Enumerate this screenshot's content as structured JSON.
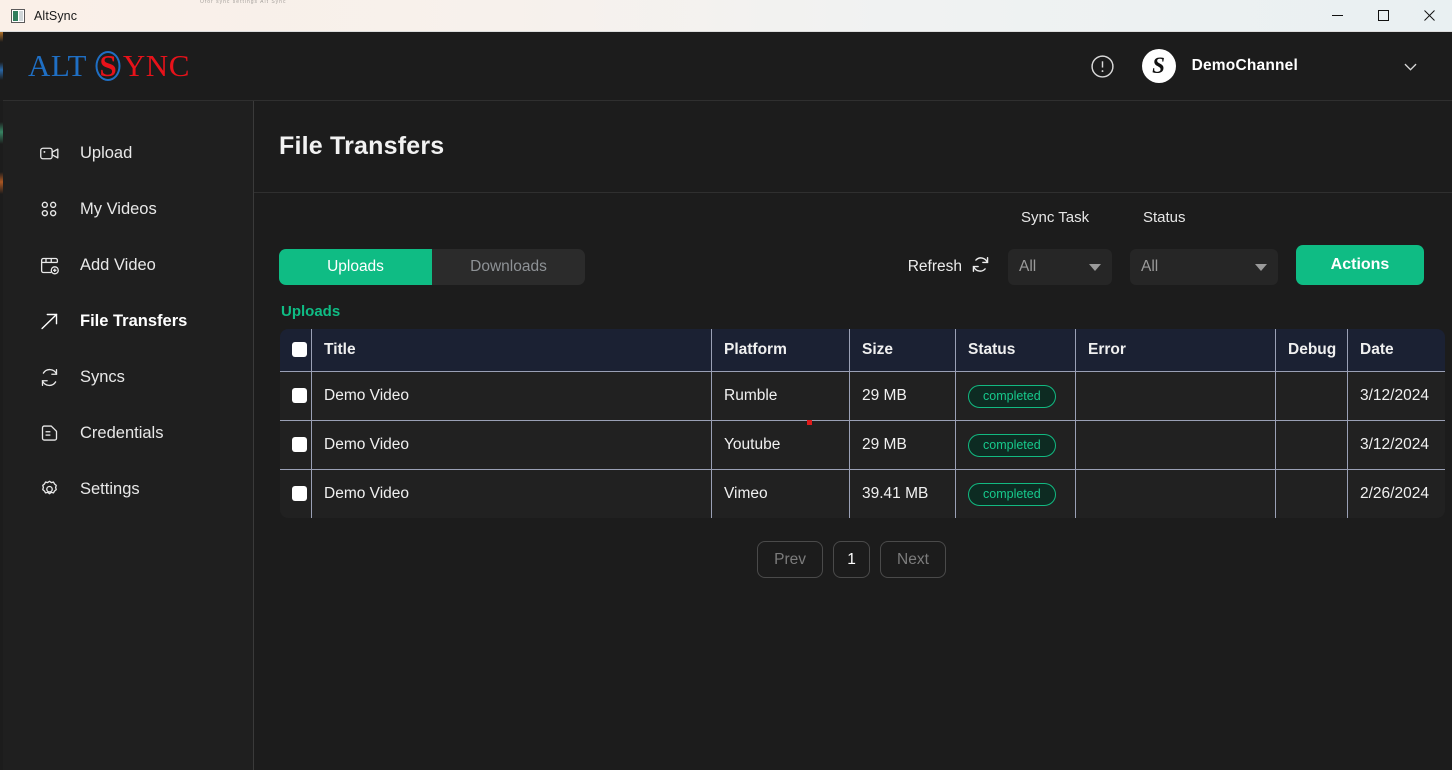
{
  "window": {
    "title": "AltSync",
    "app_icon": "app-window-icon",
    "minimize_label": "minimize-icon",
    "maximize_label": "maximize-icon",
    "close_label": "close-icon",
    "ghost_text": "Ofor sync settings  Alt Sync"
  },
  "brand": {
    "alt": "ALT",
    "s": "S",
    "ync": "YNC"
  },
  "header": {
    "alert_icon": "alert-circle-icon",
    "avatar_letter": "S",
    "channel": "DemoChannel",
    "caret_icon": "chevron-down-icon"
  },
  "sidebar": {
    "items": [
      {
        "label": "Upload",
        "icon": "video-camera-icon",
        "active": false
      },
      {
        "label": "My Videos",
        "icon": "grid-dots-icon",
        "active": false
      },
      {
        "label": "Add Video",
        "icon": "image-plus-icon",
        "active": false
      },
      {
        "label": "File Transfers",
        "icon": "arrow-up-right-icon",
        "active": true
      },
      {
        "label": "Syncs",
        "icon": "refresh-cw-icon",
        "active": false
      },
      {
        "label": "Credentials",
        "icon": "file-text-icon",
        "active": false
      },
      {
        "label": "Settings",
        "icon": "gear-icon",
        "active": false
      }
    ]
  },
  "page": {
    "title": "File Transfers"
  },
  "toolbar": {
    "tab_uploads": "Uploads",
    "tab_downloads": "Downloads",
    "active_tab": "Uploads",
    "refresh_label": "Refresh",
    "refresh_icon": "refresh-icon",
    "sync_task_label": "Sync Task",
    "sync_task_value": "All",
    "status_label": "Status",
    "status_value": "All",
    "actions_label": "Actions"
  },
  "table": {
    "caption": "Uploads",
    "columns": [
      "",
      "Title",
      "Platform",
      "Size",
      "Status",
      "Error",
      "Debug",
      "Date"
    ],
    "rows": [
      {
        "title": "Demo Video",
        "platform": "Rumble",
        "size": "29 MB",
        "status": "completed",
        "error": "",
        "debug": "",
        "date": "3/12/2024"
      },
      {
        "title": "Demo Video",
        "platform": "Youtube",
        "size": "29 MB",
        "status": "completed",
        "error": "",
        "debug": "",
        "date": "3/12/2024"
      },
      {
        "title": "Demo Video",
        "platform": "Vimeo",
        "size": "39.41 MB",
        "status": "completed",
        "error": "",
        "debug": "",
        "date": "2/26/2024"
      }
    ]
  },
  "pagination": {
    "prev": "Prev",
    "current": "1",
    "next": "Next"
  },
  "colors": {
    "accent_green": "#0fbc84",
    "badge_green": "#17c98c",
    "logo_blue": "#1f6fc4",
    "logo_red": "#e8121a",
    "app_bg": "#1c1c1c",
    "sidebar_bg": "#1f1f1f",
    "table_header_bg": "#1b2133"
  }
}
